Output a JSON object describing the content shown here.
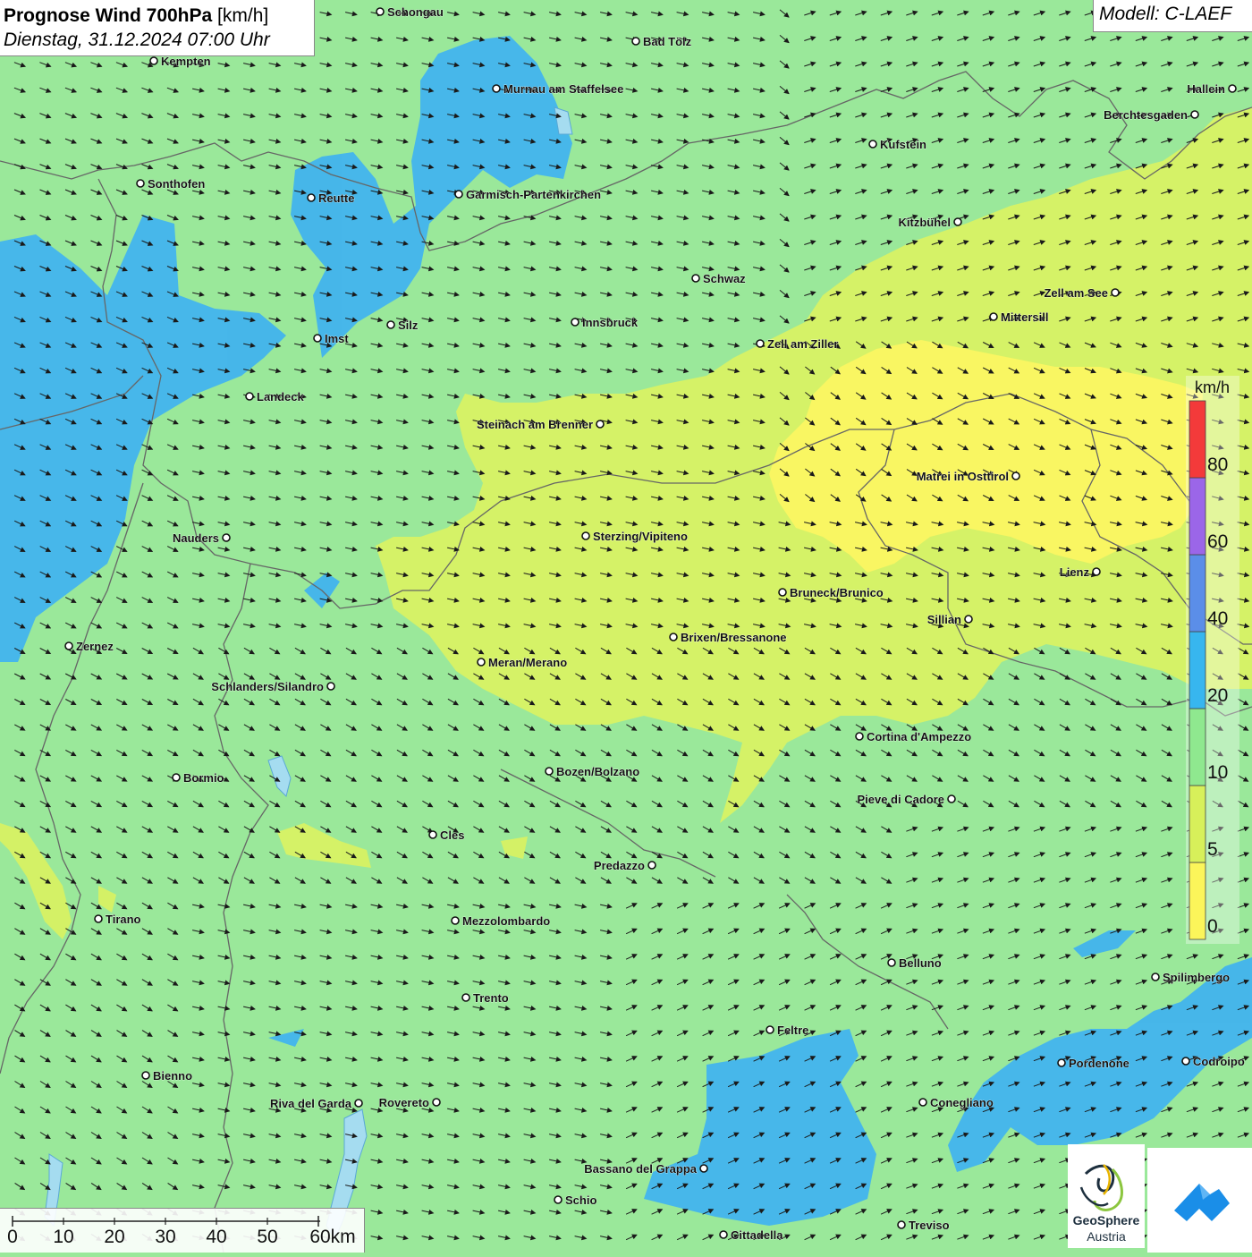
{
  "title": {
    "main": "Prognose Wind 700hPa",
    "unit": "[km/h]",
    "date": "Dienstag, 31.12.2024 07:00 Uhr"
  },
  "model": "Modell: C-LAEF",
  "legend": {
    "unit": "km/h",
    "bins": [
      {
        "from": 0,
        "to": 5,
        "color": "#fbf55a"
      },
      {
        "from": 5,
        "to": 10,
        "color": "#d7f05a"
      },
      {
        "from": 10,
        "to": 20,
        "color": "#8fe88f"
      },
      {
        "from": 20,
        "to": 40,
        "color": "#37b6ef"
      },
      {
        "from": 40,
        "to": 60,
        "color": "#5b8ee8"
      },
      {
        "from": 60,
        "to": 80,
        "color": "#9b66e8"
      },
      {
        "from": 80,
        "to": null,
        "color": "#f33a3a"
      }
    ],
    "labels": [
      "0",
      "5",
      "10",
      "20",
      "40",
      "60",
      "80"
    ]
  },
  "scale_bar": {
    "labels": [
      "0",
      "10",
      "20",
      "30",
      "40",
      "50",
      "60km"
    ]
  },
  "logos": {
    "geosphere_line1": "GeoSphere",
    "geosphere_line2": "Austria"
  },
  "cities": [
    {
      "name": "Schongau",
      "label_side": "right"
    },
    {
      "name": "Bad Tölz",
      "label_side": "right"
    },
    {
      "name": "Kempten",
      "label_side": "right"
    },
    {
      "name": "Hallein",
      "label_side": "left"
    },
    {
      "name": "Murnau am Staffelsee",
      "label_side": "right"
    },
    {
      "name": "Berchtesgaden",
      "label_side": "left"
    },
    {
      "name": "Kufstein",
      "label_side": "right"
    },
    {
      "name": "Sonthofen",
      "label_side": "right"
    },
    {
      "name": "Reutte",
      "label_side": "right"
    },
    {
      "name": "Garmisch-Partenkirchen",
      "label_side": "right"
    },
    {
      "name": "Kitzbühel",
      "label_side": "left"
    },
    {
      "name": "Schwaz",
      "label_side": "right"
    },
    {
      "name": "Zell am See",
      "label_side": "left"
    },
    {
      "name": "Mittersill",
      "label_side": "right"
    },
    {
      "name": "Innsbruck",
      "label_side": "right"
    },
    {
      "name": "Imst",
      "label_side": "right"
    },
    {
      "name": "Silz",
      "label_side": "right"
    },
    {
      "name": "Zell am Ziller",
      "label_side": "right"
    },
    {
      "name": "Landeck",
      "label_side": "right"
    },
    {
      "name": "Steinach am Brenner",
      "label_side": "left"
    },
    {
      "name": "Matrei in Osttirol",
      "label_side": "left"
    },
    {
      "name": "Sterzing/Vipiteno",
      "label_side": "right"
    },
    {
      "name": "Nauders",
      "label_side": "left"
    },
    {
      "name": "Lienz",
      "label_side": "left"
    },
    {
      "name": "Bruneck/Brunico",
      "label_side": "right"
    },
    {
      "name": "Sillian",
      "label_side": "left"
    },
    {
      "name": "Brixen/Bressanone",
      "label_side": "right"
    },
    {
      "name": "Zernez",
      "label_side": "right"
    },
    {
      "name": "Meran/Merano",
      "label_side": "right"
    },
    {
      "name": "Schlanders/Silandro",
      "label_side": "left"
    },
    {
      "name": "Cortina d'Ampezzo",
      "label_side": "right"
    },
    {
      "name": "Bozen/Bolzano",
      "label_side": "right"
    },
    {
      "name": "Bormio",
      "label_side": "right"
    },
    {
      "name": "Pieve di Cadore",
      "label_side": "left"
    },
    {
      "name": "Cles",
      "label_side": "right"
    },
    {
      "name": "Predazzo",
      "label_side": "left"
    },
    {
      "name": "Tirano",
      "label_side": "right"
    },
    {
      "name": "Mezzolombardo",
      "label_side": "right"
    },
    {
      "name": "Belluno",
      "label_side": "right"
    },
    {
      "name": "Spilimbergo",
      "label_side": "right"
    },
    {
      "name": "Trento",
      "label_side": "right"
    },
    {
      "name": "Feltre",
      "label_side": "right"
    },
    {
      "name": "Pordenone",
      "label_side": "right"
    },
    {
      "name": "Codroipo",
      "label_side": "right"
    },
    {
      "name": "Bienno",
      "label_side": "right"
    },
    {
      "name": "Riva del Garda",
      "label_side": "left"
    },
    {
      "name": "Rovereto",
      "label_side": "left"
    },
    {
      "name": "Conegliano",
      "label_side": "right"
    },
    {
      "name": "Bassano del Grappa",
      "label_side": "left"
    },
    {
      "name": "Schio",
      "label_side": "right"
    },
    {
      "name": "Treviso",
      "label_side": "right"
    },
    {
      "name": "Cittadella",
      "label_side": "right"
    }
  ]
}
